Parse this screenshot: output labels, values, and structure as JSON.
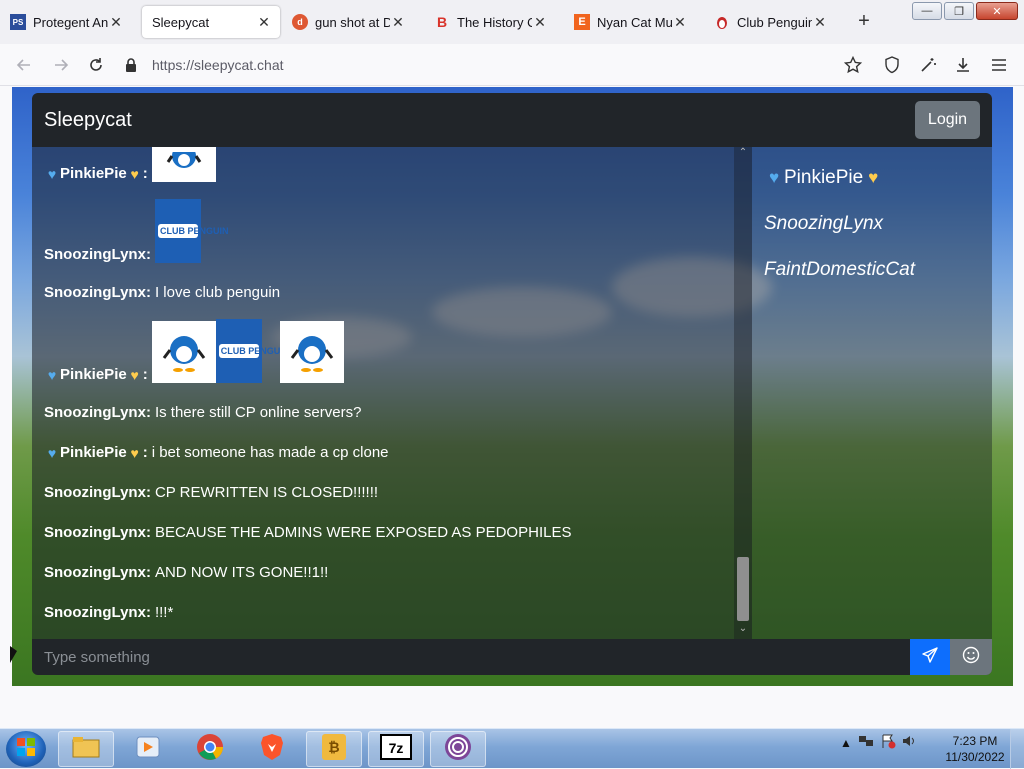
{
  "browser": {
    "tabs": [
      {
        "title": "Protegent Antiv",
        "favicon": "protegent-icon"
      },
      {
        "title": "Sleepycat",
        "favicon": "none",
        "active": true
      },
      {
        "title": "gun shot at Duc",
        "favicon": "duckduckgo-icon"
      },
      {
        "title": "The History Of",
        "favicon": "b-icon"
      },
      {
        "title": "Nyan Cat Mug",
        "favicon": "etsy-icon"
      },
      {
        "title": "Club Penguin W",
        "favicon": "penguin-icon"
      }
    ],
    "new_tab": "+",
    "url": "https://sleepycat.chat",
    "window_buttons": {
      "minimize": "—",
      "maximize": "❐",
      "close": "✕"
    }
  },
  "app": {
    "brand": "Sleepycat",
    "login_label": "Login",
    "messages": [
      {
        "user": "PinkiePie",
        "hearts": true,
        "kind": "image",
        "images": [
          "penguin"
        ],
        "partial": true
      },
      {
        "user": "SnoozingLynx",
        "hearts": false,
        "kind": "image",
        "images": [
          "club-penguin-logo"
        ]
      },
      {
        "user": "SnoozingLynx",
        "hearts": false,
        "kind": "text",
        "text": "I love club penguin"
      },
      {
        "user": "PinkiePie",
        "hearts": true,
        "kind": "image",
        "images": [
          "penguin",
          "club-penguin-logo",
          "penguin"
        ]
      },
      {
        "user": "SnoozingLynx",
        "hearts": false,
        "kind": "text",
        "text": "Is there still CP online servers?"
      },
      {
        "user": "PinkiePie",
        "hearts": true,
        "kind": "text",
        "text": "i bet someone has made a cp clone"
      },
      {
        "user": "SnoozingLynx",
        "hearts": false,
        "kind": "text",
        "text": "CP REWRITTEN IS CLOSED!!!!!!"
      },
      {
        "user": "SnoozingLynx",
        "hearts": false,
        "kind": "text",
        "text": "BECAUSE THE ADMINS WERE EXPOSED AS PEDOPHILES"
      },
      {
        "user": "SnoozingLynx",
        "hearts": false,
        "kind": "text",
        "text": "AND NOW ITS GONE!!1!!"
      },
      {
        "user": "SnoozingLynx",
        "hearts": false,
        "kind": "text",
        "text": "!!!*"
      }
    ],
    "separator": ":",
    "cp_logo_text": "CLUB PENGUIN",
    "online_users": [
      {
        "name": "PinkiePie",
        "hearts": true,
        "italic": false
      },
      {
        "name": "SnoozingLynx",
        "hearts": false,
        "italic": true
      },
      {
        "name": "FaintDomesticCat",
        "hearts": false,
        "italic": true
      }
    ],
    "input_placeholder": "Type something",
    "colors": {
      "accent_blue": "#0d6efd",
      "header_dark": "#212529",
      "login_gray": "#6c757d"
    }
  },
  "taskbar": {
    "apps": [
      "file-explorer-icon",
      "media-player-icon",
      "chrome-icon",
      "brave-icon",
      "bitwarden-icon",
      "7zip-icon",
      "tor-icon"
    ],
    "time": "7:23 PM",
    "date": "11/30/2022"
  }
}
